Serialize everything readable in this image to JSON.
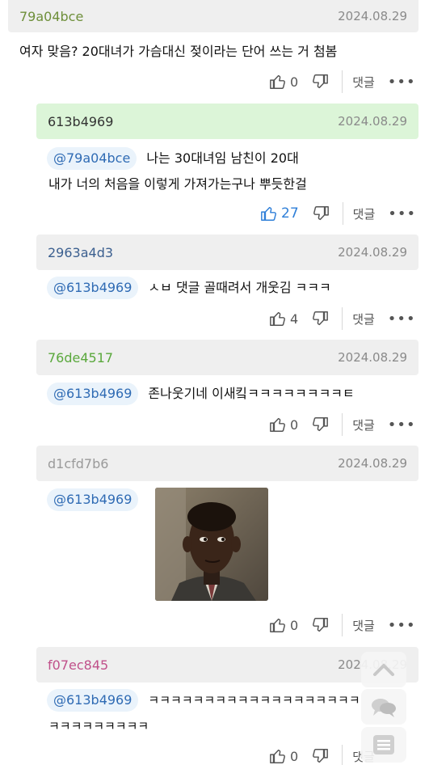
{
  "comments": [
    {
      "user": "79a04bce",
      "user_color": "#6e8f3a",
      "date": "2024.08.29",
      "text": "여자 맞음? 20대녀가 가슴대신 젖이라는 단어 쓰는 거 첨봄",
      "likes": "0",
      "reply_label": "댓글",
      "more": "•••"
    },
    {
      "user": "613b4969",
      "user_color": "#333333",
      "date": "2024.08.29",
      "mention": "@79a04bce",
      "text_line1": "나는 30대녀임 남친이 20대",
      "text_line2": "내가 너의 처음을 이렇게 가져가는구나 뿌듯한걸",
      "likes": "27",
      "reply_label": "댓글",
      "more": "•••"
    },
    {
      "user": "2963a4d3",
      "user_color": "#3b5f8f",
      "date": "2024.08.29",
      "mention": "@613b4969",
      "text": "ㅅㅂ 댓글 골때려서 개웃김 ㅋㅋㅋ",
      "likes": "4",
      "reply_label": "댓글",
      "more": "•••"
    },
    {
      "user": "76de4517",
      "user_color": "#5aa83c",
      "date": "2024.08.29",
      "mention": "@613b4969",
      "text": "존나웃기네 이새킼ㅋㅋㅋㅋㅋㅋㅋㅋㅌ",
      "likes": "0",
      "reply_label": "댓글",
      "more": "•••"
    },
    {
      "user": "d1cfd7b6",
      "user_color": "#9a9a9a",
      "date": "2024.08.29",
      "mention": "@613b4969",
      "likes": "0",
      "reply_label": "댓글",
      "more": "•••"
    },
    {
      "user": "f07ec845",
      "user_color": "#c0508a",
      "date": "2024.08.29",
      "mention": "@613b4969",
      "text_line1": "ㅋㅋㅋㅋㅋㅋㅋㅋㅋㅋㅋㅋㅋㅋㅋㅋㅋㅋㅋ",
      "text_line2": "ㅋㅋㅋㅋㅋㅋㅋㅋㅋ",
      "likes": "0",
      "reply_label": "댓글"
    }
  ],
  "accent_like_color": "#2f7fd8",
  "highlight_color": "#dcf5d8"
}
